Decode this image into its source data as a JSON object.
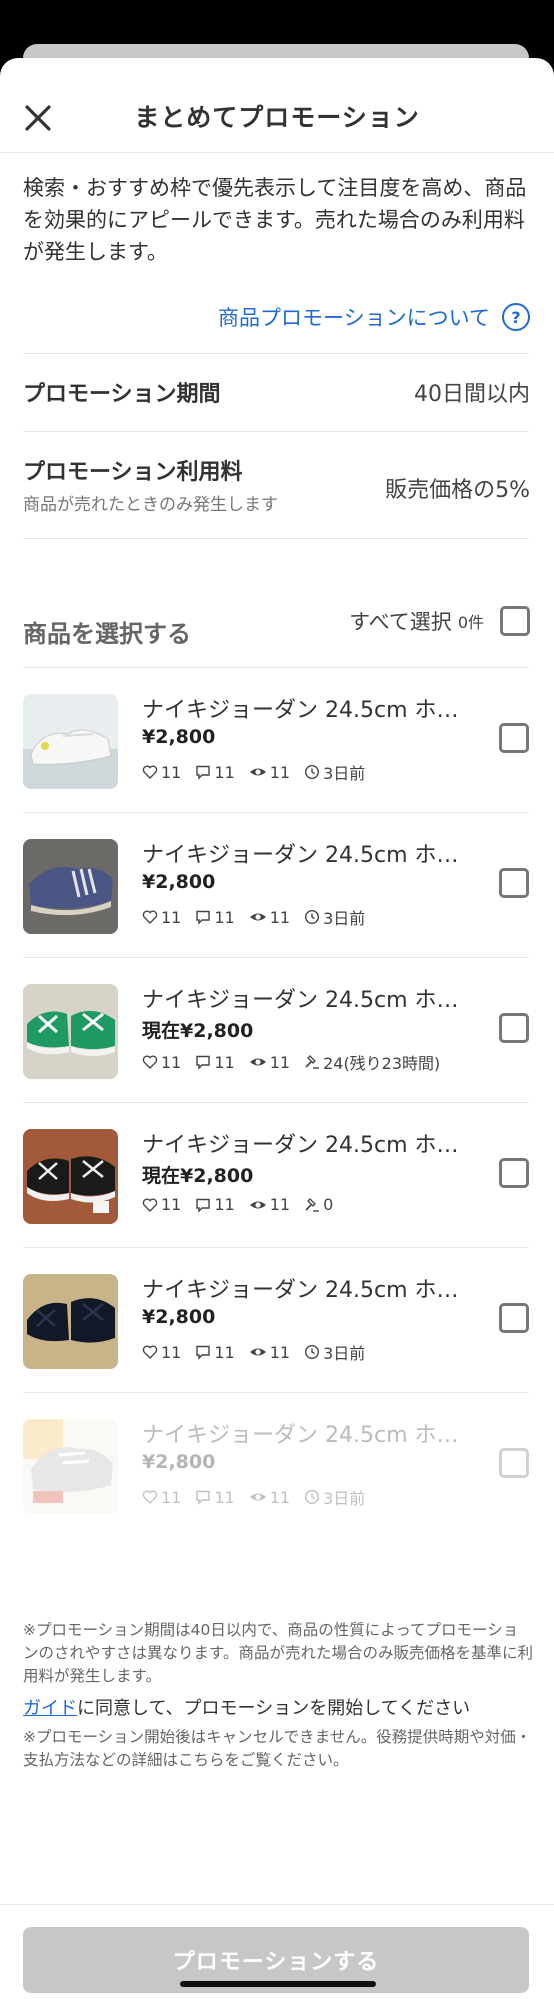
{
  "header": {
    "title": "まとめてプロモーション"
  },
  "intro": {
    "text": "検索・おすすめ枠で優先表示して注目度を高め、商品を効果的にアピールできます。売れた場合のみ利用料が発生します。"
  },
  "about_link": {
    "label": "商品プロモーションについて",
    "icon": "help-circle-icon",
    "help_glyph": "?"
  },
  "promotion_period": {
    "label": "プロモーション期間",
    "value": "40日間以内"
  },
  "promotion_fee": {
    "label": "プロモーション利用料",
    "sub": "商品が売れたときのみ発生します",
    "value": "販売価格の5%"
  },
  "select": {
    "title": "商品を選択する",
    "all_label": "すべて選択",
    "count": "0件"
  },
  "items": [
    {
      "name": "ナイキジョーダン 24.5cm ホ…",
      "price": "¥2,800",
      "likes": "11",
      "comments": "11",
      "views": "11",
      "fourth": "3日前",
      "fourth_icon": "clock-icon",
      "thumb": "white-sneaker"
    },
    {
      "name": "ナイキジョーダン 24.5cm ホ…",
      "price": "¥2,800",
      "likes": "11",
      "comments": "11",
      "views": "11",
      "fourth": "3日前",
      "fourth_icon": "clock-icon",
      "thumb": "blue-sneaker"
    },
    {
      "name": "ナイキジョーダン 24.5cm ホ…",
      "price": "現在¥2,800",
      "likes": "11",
      "comments": "11",
      "views": "11",
      "fourth": "24(残り23時間)",
      "fourth_icon": "gavel-icon",
      "thumb": "green-sneaker"
    },
    {
      "name": "ナイキジョーダン 24.5cm ホ…",
      "price": "現在¥2,800",
      "likes": "11",
      "comments": "11",
      "views": "11",
      "fourth": "0",
      "fourth_icon": "gavel-icon",
      "thumb": "black-sneaker"
    },
    {
      "name": "ナイキジョーダン 24.5cm ホ…",
      "price": "¥2,800",
      "likes": "11",
      "comments": "11",
      "views": "11",
      "fourth": "3日前",
      "fourth_icon": "clock-icon",
      "thumb": "dark-sneaker"
    },
    {
      "name": "ナイキジョーダン 24.5cm ホ…",
      "price": "¥2,800",
      "likes": "11",
      "comments": "11",
      "views": "11",
      "fourth": "3日前",
      "fourth_icon": "clock-icon",
      "thumb": "gray-sneaker",
      "disabled": true
    }
  ],
  "notice": "※プロモーション期間は40日以内で、商品の性質によってプロモーションのされやすさは異なります。商品が売れた場合のみ販売価格を基準に利用料が発生します。",
  "guide": {
    "link": "ガイド",
    "text": "に同意して、プロモーションを開始してください"
  },
  "notice2": "※プロモーション開始後はキャンセルできません。役務提供時期や対価・支払方法などの詳細はこちらをご覧ください。",
  "cta": {
    "label": "プロモーションする",
    "disabled": true
  },
  "colors": {
    "link": "#1f6bd1",
    "cta_disabled": "#c7c7c7",
    "divider": "#e6e6e6"
  }
}
